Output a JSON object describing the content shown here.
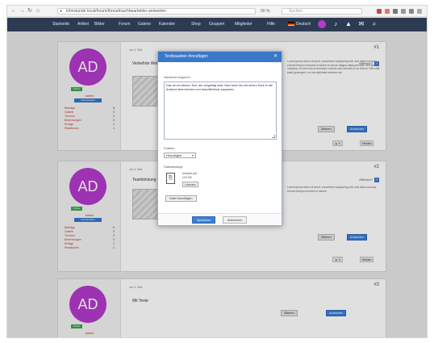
{
  "browser": {
    "url": "lohnstunde.local/forum/thread/sachbearbeiter-antworten",
    "zoom": "90 %",
    "search_placeholder": "Suchen"
  },
  "site_nav": {
    "items": [
      "Startseite",
      "Artikel",
      "Bilder",
      "Forum",
      "Galerie",
      "Kalender",
      "Shop",
      "Gruppen",
      "Mitglieder",
      "Hilfe"
    ],
    "language": "Deutsch"
  },
  "posts": [
    {
      "initials": "AD",
      "online": "Online",
      "username": "admin",
      "rank": "Administrator",
      "stats": [
        {
          "label": "Beiträge",
          "value": "6"
        },
        {
          "label": "Galerie",
          "value": "0"
        },
        {
          "label": "Themen",
          "value": "3"
        },
        {
          "label": "Bewertungen",
          "value": "0"
        },
        {
          "label": "Erfolge",
          "value": "1"
        },
        {
          "label": "Reaktionen",
          "value": "1"
        }
      ],
      "date": "vor 1 Std.",
      "number": "#1",
      "title": "Verkehrte Welt",
      "text": "Lorem ipsum dolor sit amet, consetetur sadipscing elitr, sed diam nonumy eirmod tempor invidunt ut labore et dolore magna aliquyam erat, sed diam voluptua. At vero eos et accusam et justo duo dolores et ea rebum. Stet clita kasd gubergren, no sea takimata sanctus est.",
      "hilfe": "Hilfreich?",
      "btn_zitat": "Zitieren",
      "btn_antwort": "Antworten",
      "action_small": "Melden"
    },
    {
      "initials": "AD",
      "online": "Online",
      "username": "admin",
      "rank": "Administrator",
      "stats": [
        {
          "label": "Beiträge",
          "value": "6"
        },
        {
          "label": "Galerie",
          "value": "0"
        },
        {
          "label": "Themen",
          "value": "3"
        },
        {
          "label": "Bewertungen",
          "value": "0"
        },
        {
          "label": "Erfolge",
          "value": "1"
        },
        {
          "label": "Reaktionen",
          "value": "1"
        }
      ],
      "date": "vor 1 Std.",
      "number": "#2",
      "title": "Teamleistung",
      "text": "Lorem ipsum dolor sit amet, consetetur sadipscing elitr, sed diam nonumy eirmod tempor invidunt ut labore.",
      "hilfe": "Hilfreich?",
      "btn_zitat": "Zitieren",
      "btn_antwort": "Antworten",
      "action_small": "Melden"
    },
    {
      "initials": "AD",
      "online": "Online",
      "username": "admin",
      "rank": "Administrator",
      "date": "vor 1 Std.",
      "number": "#3",
      "title": "Mit Texte",
      "btn_zitat": "Zitieren",
      "btn_antwort": "Antworten"
    }
  ],
  "modal": {
    "title": "Textbaustein hinzufügen",
    "message_label": "Nachricht eingeben",
    "message_value": "Das ist ein kleiner Text, der eingefügt wird. Man kann ihn mit einem Klick in die Antwort übernehmen und anschließend anpassen.",
    "position_label": "Position",
    "position_value": "Hinzufügen",
    "attachment_label": "Dateianhänge",
    "file_name": "beispiel.pdf",
    "file_size": "120 KB",
    "file_delete": "Löschen",
    "add_file": "Datei hinzufügen",
    "save": "Speichern",
    "cancel": "Abbrechen"
  },
  "colors": {
    "nav_bg": "#2d3b52",
    "accent_blue": "#3a78c8",
    "avatar_purple": "#b33acb",
    "online_green": "#3aa64a"
  }
}
